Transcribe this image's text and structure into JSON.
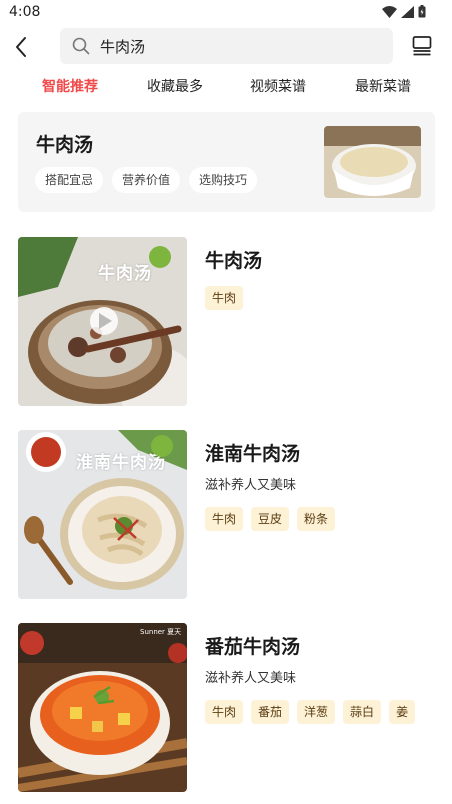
{
  "status_bar": {
    "time": "4:08"
  },
  "search": {
    "query": "牛肉汤"
  },
  "tabs": [
    {
      "label": "智能推荐",
      "active": true
    },
    {
      "label": "收藏最多",
      "active": false
    },
    {
      "label": "视频菜谱",
      "active": false
    },
    {
      "label": "最新菜谱",
      "active": false
    }
  ],
  "summary_card": {
    "title": "牛肉汤",
    "chips": [
      "搭配宜忌",
      "营养价值",
      "选购技巧"
    ]
  },
  "recipes": [
    {
      "title": "牛肉汤",
      "description": "",
      "tags": [
        "牛肉"
      ],
      "image_text": "牛肉汤",
      "has_video": true
    },
    {
      "title": "淮南牛肉汤",
      "description": "滋补养人又美味",
      "tags": [
        "牛肉",
        "豆皮",
        "粉条"
      ],
      "image_text": "淮南牛肉汤",
      "has_video": false
    },
    {
      "title": "番茄牛肉汤",
      "description": "滋补养人又美味",
      "tags": [
        "牛肉",
        "番茄",
        "洋葱",
        "蒜白",
        "姜"
      ],
      "image_text": "Sunner 夏天",
      "has_video": false
    }
  ],
  "colors": {
    "accent": "#f04a4a",
    "tag_bg": "#fdf1d6",
    "card_bg": "#f5f5f5"
  }
}
